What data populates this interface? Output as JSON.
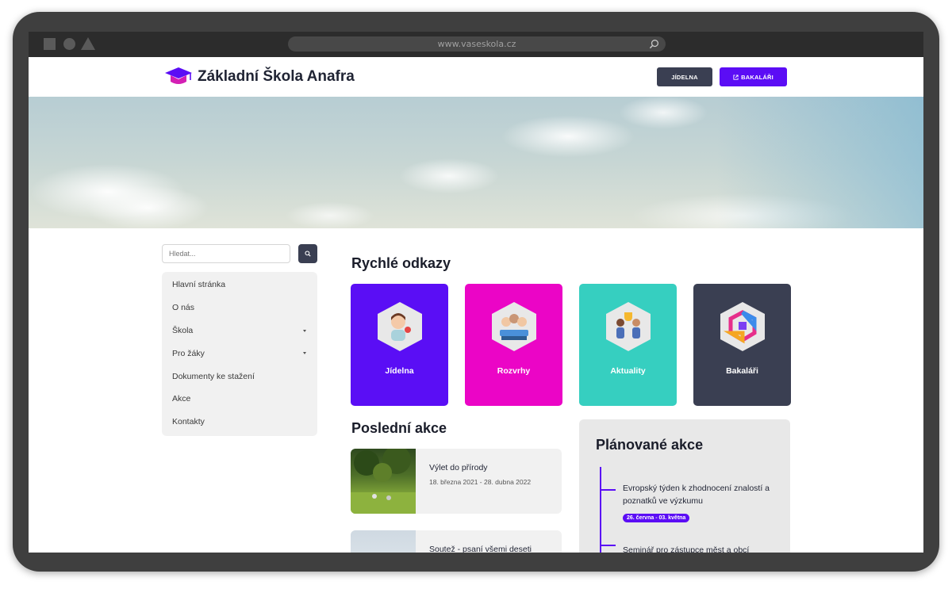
{
  "browser": {
    "url": "www.vaseskola.cz"
  },
  "header": {
    "site_title": "Základní Škola Anafra",
    "btn_jidelna": "JÍDELNA",
    "btn_bakalari": "BAKALÁŘI",
    "brand_color": "#5b0df5"
  },
  "sidebar": {
    "search_placeholder": "Hledat...",
    "items": [
      {
        "label": "Hlavní stránka"
      },
      {
        "label": "O nás"
      },
      {
        "label": "Škola"
      },
      {
        "label": "Pro žáky"
      },
      {
        "label": "Dokumenty ke stažení"
      },
      {
        "label": "Akce"
      },
      {
        "label": "Kontakty"
      }
    ]
  },
  "quick_links": {
    "title": "Rychlé odkazy",
    "cards": [
      {
        "label": "Jídelna",
        "color": "#5a0ef5",
        "icon": "chef-illustration-icon"
      },
      {
        "label": "Rozvrhy",
        "color": "#eb05c6",
        "icon": "students-illustration-icon"
      },
      {
        "label": "Aktuality",
        "color": "#36cfc0",
        "icon": "trophy-illustration-icon"
      },
      {
        "label": "Bakaláři",
        "color": "#3a3f52",
        "icon": "bakalari-logo-icon"
      }
    ]
  },
  "recent_events": {
    "title": "Poslední akce",
    "items": [
      {
        "title": "Výlet do přírody",
        "date": "18. března 2021 - 28. dubna 2022"
      },
      {
        "title": "Soutež - psaní všemi deseti",
        "date": ""
      }
    ]
  },
  "planned_events": {
    "title": "Plánované akce",
    "items": [
      {
        "title": "Evropský týden k zhodnocení znalostí a poznatků ve výzkumu",
        "date": "26. června - 03. května"
      },
      {
        "title": "Seminář pro zástupce měst a obcí",
        "date": ""
      }
    ]
  }
}
